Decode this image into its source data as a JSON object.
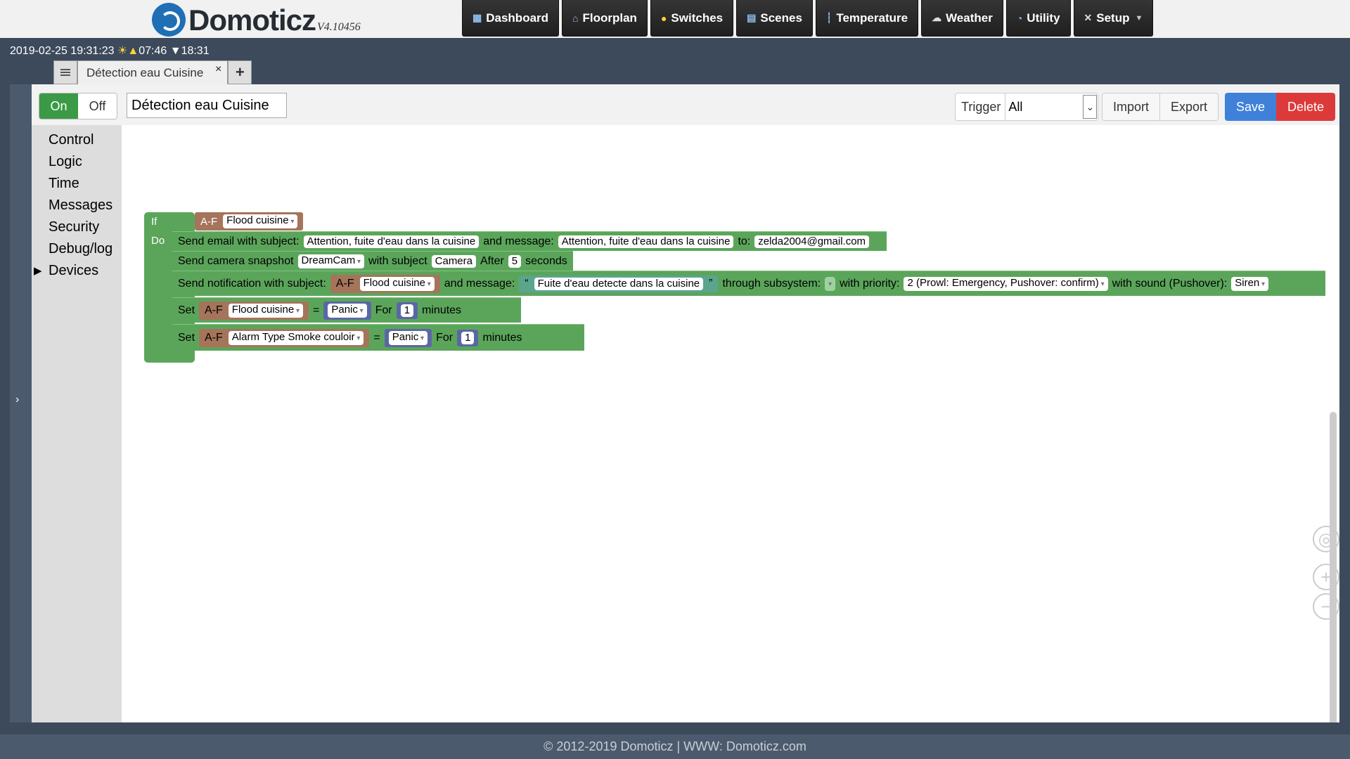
{
  "app": {
    "logo_text": "Domoticz",
    "version": "V4.10456"
  },
  "nav": [
    {
      "label": "Dashboard",
      "icon": "dashboard-icon"
    },
    {
      "label": "Floorplan",
      "icon": "floorplan-icon"
    },
    {
      "label": "Switches",
      "icon": "lightbulb-icon"
    },
    {
      "label": "Scenes",
      "icon": "scenes-icon"
    },
    {
      "label": "Temperature",
      "icon": "thermometer-icon"
    },
    {
      "label": "Weather",
      "icon": "weather-icon"
    },
    {
      "label": "Utility",
      "icon": "utility-icon"
    },
    {
      "label": "Setup",
      "icon": "tools-icon"
    }
  ],
  "status": {
    "datetime": "2019-02-25 19:31:23",
    "sunrise_symbol": "☀▲",
    "sunrise": "07:46",
    "sunset_symbol": "▼",
    "sunset": "18:31"
  },
  "tab": {
    "title": "Détection eau Cuisine",
    "close_symbol": "×",
    "add_symbol": "+"
  },
  "toolbar": {
    "on_label": "On",
    "off_label": "Off",
    "script_name": "Détection eau Cuisine",
    "trigger_label": "Trigger",
    "trigger_value": "All",
    "import_label": "Import",
    "export_label": "Export",
    "save_label": "Save",
    "delete_label": "Delete"
  },
  "toolbox": {
    "categories": [
      "Control",
      "Logic",
      "Time",
      "Messages",
      "Security",
      "Debug/log",
      "Devices"
    ],
    "expand_arrow": "▶"
  },
  "blocks": {
    "if_label": "If",
    "do_label": "Do",
    "if_device_type": "A-F",
    "if_device": "Flood cuisine",
    "email": {
      "label": "Send email with subject:",
      "subject": "Attention, fuite d'eau dans la cuisine",
      "message_label": "and message:",
      "message": "Attention, fuite d'eau dans la cuisine",
      "to_label": "to:",
      "to": "zelda2004@gmail.com"
    },
    "camera": {
      "label": "Send camera snapshot",
      "camera": "DreamCam",
      "subject_label": "with subject",
      "subject": "Camera",
      "after_label": "After",
      "after": "5",
      "seconds_label": "seconds"
    },
    "notification": {
      "label": "Send notification with subject:",
      "device_type": "A-F",
      "device": "Flood cuisine",
      "message_label": "and message:",
      "quote_open": "“",
      "message": "Fuite d'eau detecte dans la cuisine",
      "quote_close": "”",
      "subsystem_label": "through subsystem:",
      "priority_label": "with priority:",
      "priority": "2 (Prowl: Emergency, Pushover: confirm)",
      "sound_label": "with sound (Pushover):",
      "sound": "Siren"
    },
    "set1": {
      "set_label": "Set",
      "device_type": "A-F",
      "device": "Flood cuisine",
      "eq": "=",
      "value": "Panic",
      "for_label": "For",
      "for_value": "1",
      "unit": "minutes"
    },
    "set2": {
      "set_label": "Set",
      "device_type": "A-F",
      "device": "Alarm Type Smoke couloir",
      "eq": "=",
      "value": "Panic",
      "for_label": "For",
      "for_value": "1",
      "unit": "minutes"
    }
  },
  "workspace": {
    "zoom_in": "+",
    "zoom_out": "−"
  },
  "footer": {
    "text": "© 2012-2019 Domoticz | WWW: Domoticz.com"
  },
  "colors": {
    "block_green": "#5ba55b",
    "block_brown": "#a5745b",
    "block_purple": "#5b67a5",
    "block_teal": "#5ba58c",
    "save_blue": "#3f80d9",
    "delete_red": "#dc3a3a"
  }
}
